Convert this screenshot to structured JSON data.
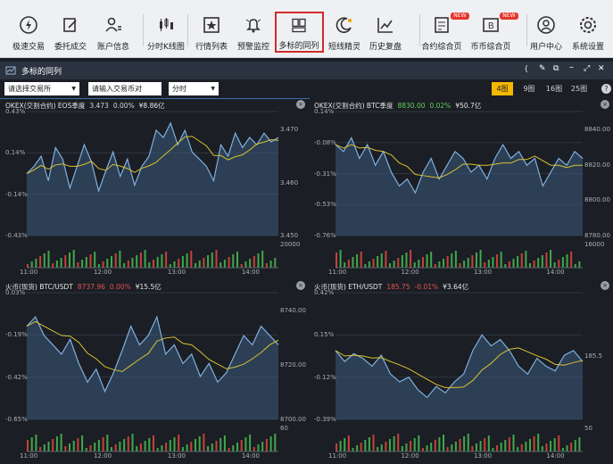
{
  "toolbar": [
    {
      "name": "quick-trade",
      "label": "极速交易",
      "icon": "lightning-icon"
    },
    {
      "name": "order-entrust",
      "label": "委托成交",
      "icon": "edit-icon"
    },
    {
      "name": "account-info",
      "label": "账户信息",
      "icon": "user-icon"
    },
    {
      "name": "time-kline",
      "label": "分时K线图",
      "icon": "candlestick-icon"
    },
    {
      "name": "quote-list",
      "label": "行情列表",
      "icon": "star-box-icon"
    },
    {
      "name": "alert-monitor",
      "label": "预警监控",
      "icon": "bell-icon"
    },
    {
      "name": "multi-symbol",
      "label": "多标的同列",
      "icon": "grid-icon"
    },
    {
      "name": "short-line",
      "label": "短线精灵",
      "icon": "moon-icon"
    },
    {
      "name": "history-replay",
      "label": "历史复盘",
      "icon": "chart-icon"
    },
    {
      "name": "contract-overview",
      "label": "合约综合页",
      "icon": "contract-icon",
      "badge": "NEW"
    },
    {
      "name": "coin-overview",
      "label": "币币综合页",
      "icon": "coin-icon",
      "badge": "NEW"
    },
    {
      "name": "user-center",
      "label": "用户中心",
      "icon": "person-circle-icon"
    },
    {
      "name": "system-settings",
      "label": "系统设置",
      "icon": "gear-icon"
    }
  ],
  "window": {
    "title": "多标的同列"
  },
  "controls": {
    "exchange": "请选择交易所",
    "pair": "请输入交易币对",
    "period": "分时"
  },
  "ranges": [
    "4图",
    "9图",
    "16图",
    "25图"
  ],
  "panels": [
    {
      "exchange": "OKEX(交割合约) EOS季度",
      "price": "3.473",
      "change": "0.00%",
      "volume": "¥8.86亿",
      "change_color": "#cfd3d9",
      "left_ticks": [
        "0.43%",
        "0.14%",
        "-0.14%",
        "-0.43%"
      ],
      "right_ticks": [
        "3.470",
        "3.460",
        "3.450"
      ],
      "vol_tick": "20000",
      "time_ticks": [
        "11:00",
        "12:00",
        "13:00",
        "14:00"
      ],
      "chart_data": {
        "type": "line",
        "series": [
          {
            "values": [
              0.0,
              0.05,
              0.12,
              -0.05,
              0.18,
              0.1,
              -0.1,
              0.05,
              0.2,
              0.08,
              -0.12,
              0.02,
              0.15,
              -0.02,
              0.1,
              -0.08,
              0.05,
              0.12,
              0.3,
              0.25,
              0.35,
              0.2,
              0.3,
              0.15,
              0.1,
              0.05,
              -0.05,
              0.2,
              0.12,
              0.28,
              0.18,
              0.25,
              0.2,
              0.28,
              0.22,
              0.25
            ]
          }
        ],
        "ylim": [
          -0.43,
          0.43
        ]
      }
    },
    {
      "exchange": "OKEX(交割合约) BTC季度",
      "price": "8830.00",
      "change": "0.02%",
      "volume": "¥50.7亿",
      "change_color": "#5fcf5a",
      "left_ticks": [
        "0.14%",
        "-0.08%",
        "-0.31%",
        "-0.53%",
        "-0.76%"
      ],
      "right_ticks": [
        "8840.00",
        "8820.00",
        "8800.00",
        "8780.00"
      ],
      "vol_tick": "16000",
      "time_ticks": [
        "11:00",
        "12:00",
        "13:00",
        "14:00"
      ],
      "chart_data": {
        "type": "line",
        "series": [
          {
            "values": [
              -0.1,
              -0.15,
              -0.05,
              -0.2,
              -0.1,
              -0.25,
              -0.15,
              -0.3,
              -0.4,
              -0.35,
              -0.45,
              -0.3,
              -0.2,
              -0.35,
              -0.25,
              -0.15,
              -0.2,
              -0.3,
              -0.25,
              -0.35,
              -0.2,
              -0.1,
              -0.2,
              -0.15,
              -0.25,
              -0.2,
              -0.4,
              -0.3,
              -0.2,
              -0.25,
              -0.15,
              -0.2
            ]
          }
        ],
        "ylim": [
          -0.76,
          0.14
        ]
      }
    },
    {
      "exchange": "火币(现货) BTC/USDT",
      "price": "8737.96",
      "change": "0.00%",
      "volume": "¥15.5亿",
      "change_color": "#e25555",
      "left_ticks": [
        "0.03%",
        "-0.19%",
        "-0.42%",
        "-0.65%"
      ],
      "right_ticks": [
        "8740.00",
        "8720.00",
        "8700.00"
      ],
      "vol_tick": "60",
      "time_ticks": [
        "11:00",
        "12:00",
        "13:00",
        "14:00"
      ],
      "chart_data": {
        "type": "line",
        "series": [
          {
            "values": [
              -0.15,
              -0.1,
              -0.2,
              -0.25,
              -0.3,
              -0.22,
              -0.35,
              -0.45,
              -0.38,
              -0.5,
              -0.4,
              -0.28,
              -0.15,
              -0.25,
              -0.2,
              -0.1,
              -0.3,
              -0.25,
              -0.35,
              -0.3,
              -0.42,
              -0.35,
              -0.45,
              -0.4,
              -0.3,
              -0.2,
              -0.25,
              -0.15,
              -0.2,
              -0.25
            ]
          }
        ],
        "ylim": [
          -0.65,
          0.03
        ]
      }
    },
    {
      "exchange": "火币(现货) ETH/USDT",
      "price": "185.75",
      "change": "-0.01%",
      "volume": "¥3.64亿",
      "change_color": "#e25555",
      "left_ticks": [
        "0.42%",
        "0.15%",
        "-0.12%",
        "-0.39%"
      ],
      "right_ticks": [
        "185.5"
      ],
      "vol_tick": "50",
      "time_ticks": [
        "11:00",
        "12:00",
        "13:00",
        "14:00"
      ],
      "chart_data": {
        "type": "line",
        "series": [
          {
            "values": [
              0.05,
              -0.02,
              0.03,
              0.0,
              -0.05,
              0.02,
              -0.1,
              -0.15,
              -0.12,
              -0.2,
              -0.25,
              -0.18,
              -0.22,
              -0.15,
              -0.1,
              0.05,
              0.15,
              0.08,
              0.12,
              0.05,
              -0.05,
              -0.1,
              0.0,
              -0.05,
              -0.08,
              0.02,
              0.05,
              -0.02
            ]
          }
        ],
        "ylim": [
          -0.39,
          0.42
        ]
      }
    }
  ]
}
